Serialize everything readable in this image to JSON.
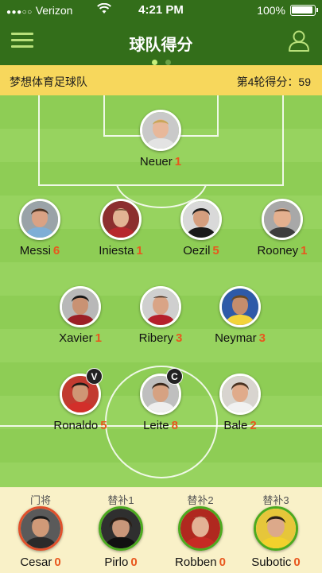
{
  "status_bar": {
    "carrier": "Verizon",
    "time": "4:21 PM",
    "battery": "100%"
  },
  "nav": {
    "title": "球队得分",
    "pages": 2,
    "active_page": 1
  },
  "info": {
    "team_name": "梦想体育足球队",
    "round_score_label": "第4轮得分：",
    "round_score": "59"
  },
  "colors": {
    "header": "#336e1a",
    "info_bar": "#f7d75c",
    "pitch": "#8ecd55",
    "points": "#e8571e",
    "bench": "#f9f1c8"
  },
  "lineup": {
    "goalkeeper": {
      "name": "Neuer",
      "points": "1"
    },
    "defenders": [
      {
        "name": "Messi",
        "points": "6"
      },
      {
        "name": "Iniesta",
        "points": "1"
      },
      {
        "name": "Oezil",
        "points": "5"
      },
      {
        "name": "Rooney",
        "points": "1"
      }
    ],
    "midfielders": [
      {
        "name": "Xavier",
        "points": "1"
      },
      {
        "name": "Ribery",
        "points": "3"
      },
      {
        "name": "Neymar",
        "points": "3"
      }
    ],
    "forwards": [
      {
        "name": "Ronaldo",
        "points": "5",
        "badge": "V"
      },
      {
        "name": "Leite",
        "points": "8",
        "badge": "C"
      },
      {
        "name": "Bale",
        "points": "2"
      }
    ]
  },
  "bench": [
    {
      "label": "门将",
      "name": "Cesar",
      "points": "0"
    },
    {
      "label": "替补1",
      "name": "Pirlo",
      "points": "0"
    },
    {
      "label": "替补2",
      "name": "Robben",
      "points": "0"
    },
    {
      "label": "替补3",
      "name": "Subotic",
      "points": "0"
    }
  ]
}
